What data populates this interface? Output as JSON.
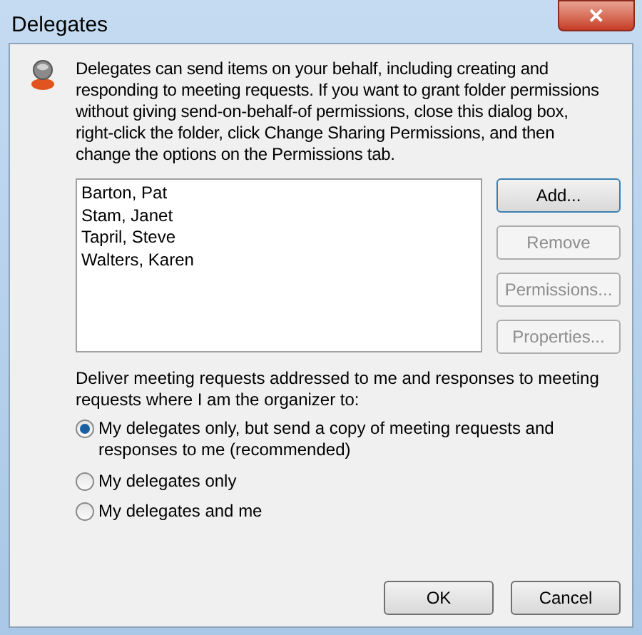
{
  "window": {
    "title": "Delegates",
    "close": "✕"
  },
  "intro": "Delegates can send items on your behalf, including creating and responding to meeting requests. If you want to grant folder permissions without giving send-on-behalf-of permissions, close this dialog box, right-click the folder, click Change Sharing Permissions, and then change the options on the Permissions tab.",
  "delegates": [
    "Barton, Pat",
    "Stam, Janet",
    "Tapril, Steve",
    "Walters, Karen"
  ],
  "side_buttons": [
    {
      "label": "Add...",
      "disabled": false,
      "default": true
    },
    {
      "label": "Remove",
      "disabled": true,
      "default": false
    },
    {
      "label": "Permissions...",
      "disabled": true,
      "default": false
    },
    {
      "label": "Properties...",
      "disabled": true,
      "default": false
    }
  ],
  "deliver_label": "Deliver meeting requests addressed to me and responses to meeting requests where I am the organizer to:",
  "options": [
    {
      "label": "My delegates only, but send a copy of meeting requests and responses to me (recommended)",
      "selected": true
    },
    {
      "label": "My delegates only",
      "selected": false
    },
    {
      "label": "My delegates and me",
      "selected": false
    }
  ],
  "buttons": [
    "OK",
    "Cancel"
  ]
}
